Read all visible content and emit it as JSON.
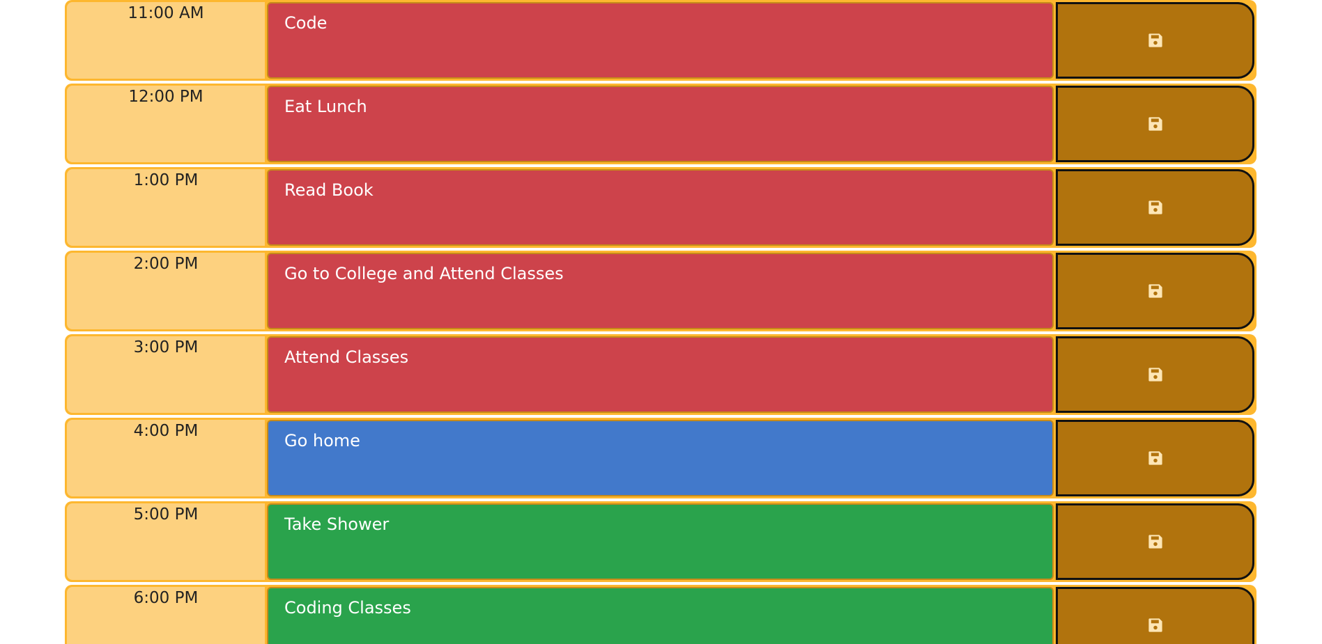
{
  "colors": {
    "row_border": "#fdb72f",
    "hour_bg": "#fdd17f",
    "past": "#cd434b",
    "present": "#4279cb",
    "future": "#2aa34c",
    "save_bg": "#b1730d",
    "save_icon": "#fde6b6"
  },
  "rows": [
    {
      "hour": "11:00 AM",
      "task": "Code",
      "state": "past",
      "icon": "save-icon"
    },
    {
      "hour": "12:00 PM",
      "task": "Eat Lunch",
      "state": "past",
      "icon": "save-icon"
    },
    {
      "hour": "1:00 PM",
      "task": "Read Book",
      "state": "past",
      "icon": "save-icon"
    },
    {
      "hour": "2:00 PM",
      "task": "Go to College and Attend Classes",
      "state": "past",
      "icon": "save-icon"
    },
    {
      "hour": "3:00 PM",
      "task": "Attend Classes",
      "state": "past",
      "icon": "save-icon"
    },
    {
      "hour": "4:00 PM",
      "task": "Go home",
      "state": "present",
      "icon": "save-icon"
    },
    {
      "hour": "5:00 PM",
      "task": "Take Shower",
      "state": "future",
      "icon": "save-icon"
    },
    {
      "hour": "6:00 PM",
      "task": "Coding Classes",
      "state": "future",
      "icon": "save-icon"
    }
  ]
}
